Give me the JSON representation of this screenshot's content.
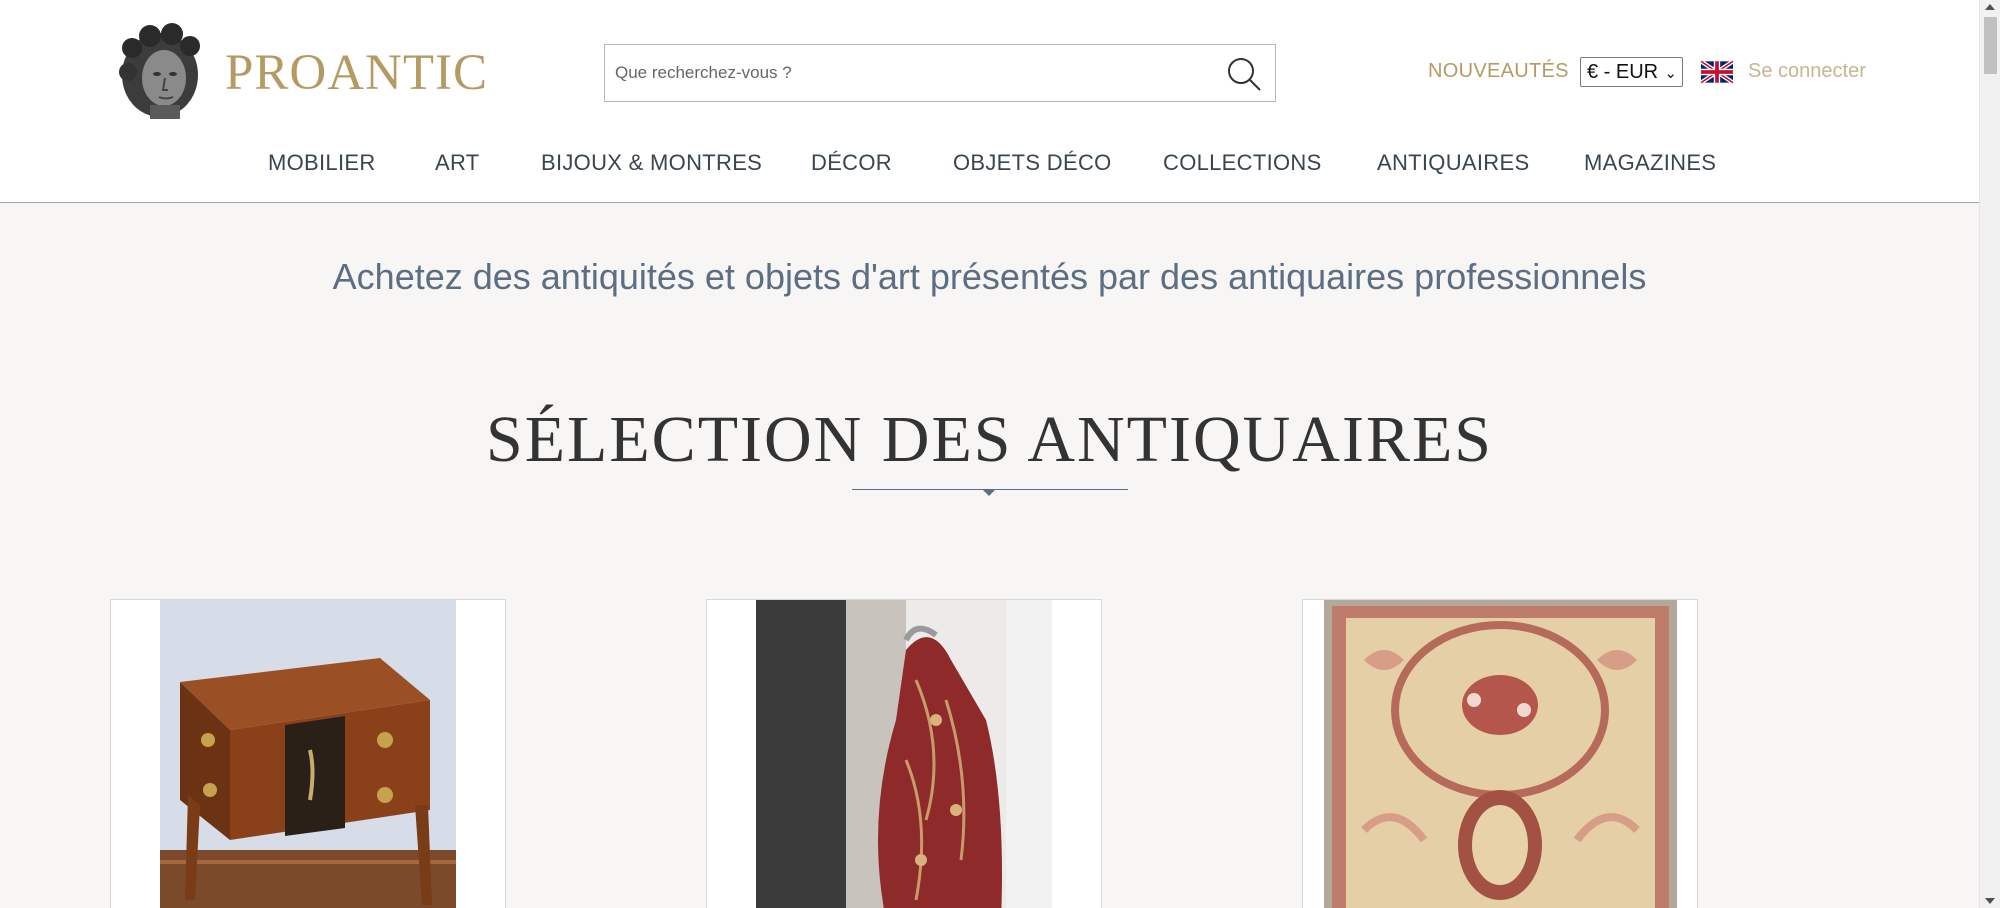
{
  "header": {
    "brand": "PROANTIC",
    "search": {
      "placeholder": "Que recherchez-vous ?"
    },
    "news_link": "NOUVEAUTÉS",
    "currency": {
      "selected": "€ - EUR"
    },
    "language_flag": "uk-flag-icon",
    "login_link": "Se connecter"
  },
  "nav": {
    "items": [
      {
        "label": "MOBILIER"
      },
      {
        "label": "ART"
      },
      {
        "label": "BIJOUX & MONTRES"
      },
      {
        "label": "DÉCOR"
      },
      {
        "label": "OBJETS DÉCO"
      },
      {
        "label": "COLLECTIONS"
      },
      {
        "label": "ANTIQUAIRES"
      },
      {
        "label": "MAGAZINES"
      }
    ]
  },
  "main": {
    "tagline": "Achetez des antiquités et objets d'art présentés par des antiquaires professionnels",
    "section_title": "SÉLECTION DES ANTIQUAIRES",
    "cards": [
      {
        "image": "inlaid-commode-image"
      },
      {
        "image": "paisley-shawl-image"
      },
      {
        "image": "aubusson-rug-image"
      }
    ]
  },
  "colors": {
    "brand_gold": "#b69a63",
    "nav_text": "#3a4552",
    "tagline_blue": "#5b6e84",
    "page_bg": "#f7f6f4"
  }
}
